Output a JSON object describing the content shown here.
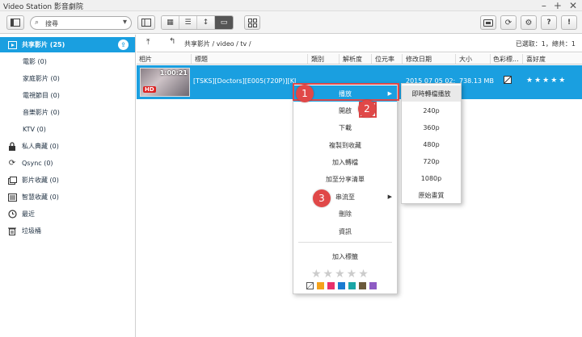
{
  "window": {
    "title": "Video Station 影音劇院",
    "controls": [
      "–",
      "+",
      "✕"
    ]
  },
  "toolbar": {
    "search_value": "搜尋"
  },
  "sidebar": {
    "items": [
      {
        "label": "共享影片 (25)",
        "icon": "film-icon"
      },
      {
        "label": "電影 (0)"
      },
      {
        "label": "家庭影片 (0)"
      },
      {
        "label": "電視節目 (0)"
      },
      {
        "label": "音樂影片 (0)"
      },
      {
        "label": "KTV (0)"
      },
      {
        "label": "私人典藏 (0)",
        "icon": "lock-icon"
      },
      {
        "label": "Qsync (0)",
        "icon": "sync-icon"
      },
      {
        "label": "影片收藏 (0)",
        "icon": "collection-icon"
      },
      {
        "label": "智慧收藏 (0)",
        "icon": "smart-collection-icon"
      },
      {
        "label": "最近",
        "icon": "clock-icon"
      },
      {
        "label": "垃圾桶",
        "icon": "trash-icon"
      }
    ]
  },
  "path": {
    "crumb": "共享影片 / video / tv /",
    "count": "已選取：1，總共：1"
  },
  "table": {
    "headers": [
      "相片",
      "標題",
      "類別",
      "解析度",
      "位元率",
      "修改日期",
      "大小",
      "色彩標...",
      "喜好度"
    ],
    "row": {
      "duration": "1:00:21",
      "hd": "HD",
      "title": "[TSKS][Doctors][E005(720P)][KI",
      "date": "2015 07 05 02:",
      "size": "738.13 MB",
      "stars": "★★★★★"
    }
  },
  "context_menu": {
    "items": [
      "播放",
      "開啟",
      "下載",
      "複製到收藏",
      "加入轉檔",
      "加至分享清單",
      "串流至",
      "刪除",
      "資訊"
    ],
    "tag_label": "加入標籤",
    "stars": "★★★★★",
    "swatches": [
      "#f5a21b",
      "#e8306b",
      "#1a7bd1",
      "#1aa6a6",
      "#6b5a3b",
      "#8e5bc4"
    ]
  },
  "submenu": {
    "items": [
      "即時轉檔播放",
      "240p",
      "360p",
      "480p",
      "720p",
      "1080p",
      "原始畫質"
    ]
  },
  "callouts": [
    "1",
    "2",
    "3"
  ],
  "colors": {
    "accent": "#1a9fe0",
    "callout": "#e04848"
  }
}
